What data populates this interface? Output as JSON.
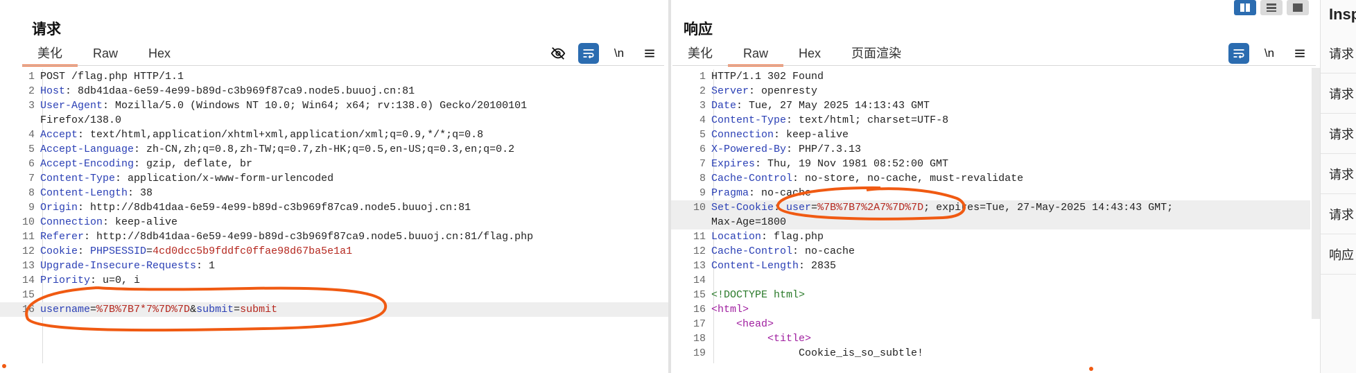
{
  "request": {
    "title": "请求",
    "tabs": [
      "美化",
      "Raw",
      "Hex"
    ],
    "active_tab": 0,
    "tool_newline": "\\n",
    "lines": [
      {
        "n": "1",
        "parts": [
          [
            "v",
            "POST /flag.php HTTP/1.1"
          ]
        ]
      },
      {
        "n": "2",
        "parts": [
          [
            "k",
            "Host"
          ],
          [
            "v",
            ": 8db41daa-6e59-4e99-b89d-c3b969f87ca9.node5.buuoj.cn:81"
          ]
        ]
      },
      {
        "n": "3",
        "parts": [
          [
            "k",
            "User-Agent"
          ],
          [
            "v",
            ": Mozilla/5.0 (Windows NT 10.0; Win64; x64; rv:138.0) Gecko/20100101"
          ]
        ]
      },
      {
        "n": "",
        "parts": [
          [
            "v",
            "Firefox/138.0"
          ]
        ]
      },
      {
        "n": "4",
        "parts": [
          [
            "k",
            "Accept"
          ],
          [
            "v",
            ": text/html,application/xhtml+xml,application/xml;q=0.9,*/*;q=0.8"
          ]
        ]
      },
      {
        "n": "5",
        "parts": [
          [
            "k",
            "Accept-Language"
          ],
          [
            "v",
            ": zh-CN,zh;q=0.8,zh-TW;q=0.7,zh-HK;q=0.5,en-US;q=0.3,en;q=0.2"
          ]
        ]
      },
      {
        "n": "6",
        "parts": [
          [
            "k",
            "Accept-Encoding"
          ],
          [
            "v",
            ": gzip, deflate, br"
          ]
        ]
      },
      {
        "n": "7",
        "parts": [
          [
            "k",
            "Content-Type"
          ],
          [
            "v",
            ": application/x-www-form-urlencoded"
          ]
        ]
      },
      {
        "n": "8",
        "parts": [
          [
            "k",
            "Content-Length"
          ],
          [
            "v",
            ": 38"
          ]
        ]
      },
      {
        "n": "9",
        "parts": [
          [
            "k",
            "Origin"
          ],
          [
            "v",
            ": http://8db41daa-6e59-4e99-b89d-c3b969f87ca9.node5.buuoj.cn:81"
          ]
        ]
      },
      {
        "n": "10",
        "parts": [
          [
            "k",
            "Connection"
          ],
          [
            "v",
            ": keep-alive"
          ]
        ]
      },
      {
        "n": "11",
        "parts": [
          [
            "k",
            "Referer"
          ],
          [
            "v",
            ": http://8db41daa-6e59-4e99-b89d-c3b969f87ca9.node5.buuoj.cn:81/flag.php"
          ]
        ]
      },
      {
        "n": "12",
        "parts": [
          [
            "k",
            "Cookie"
          ],
          [
            "v",
            ": "
          ],
          [
            "k",
            "PHPSESSID"
          ],
          [
            "v",
            "="
          ],
          [
            "r",
            "4cd0dcc5b9fddfc0ffae98d67ba5e1a1"
          ]
        ]
      },
      {
        "n": "13",
        "parts": [
          [
            "k",
            "Upgrade-Insecure-Requests"
          ],
          [
            "v",
            ": 1"
          ]
        ]
      },
      {
        "n": "14",
        "parts": [
          [
            "k",
            "Priority"
          ],
          [
            "v",
            ": u=0, i"
          ]
        ]
      },
      {
        "n": "15",
        "parts": []
      },
      {
        "n": "16",
        "hl": true,
        "parts": [
          [
            "k",
            "username"
          ],
          [
            "v",
            "="
          ],
          [
            "r",
            "%7B%7B7*7%7D%7D"
          ],
          [
            "v",
            "&"
          ],
          [
            "k",
            "submit"
          ],
          [
            "v",
            "="
          ],
          [
            "r",
            "submit"
          ]
        ]
      }
    ]
  },
  "response": {
    "title": "响应",
    "tabs": [
      "美化",
      "Raw",
      "Hex",
      "页面渲染"
    ],
    "active_tab": 1,
    "tool_newline": "\\n",
    "lines": [
      {
        "n": "1",
        "parts": [
          [
            "v",
            "HTTP/1.1 302 Found"
          ]
        ]
      },
      {
        "n": "2",
        "parts": [
          [
            "k",
            "Server"
          ],
          [
            "v",
            ": openresty"
          ]
        ]
      },
      {
        "n": "3",
        "parts": [
          [
            "k",
            "Date"
          ],
          [
            "v",
            ": Tue, 27 May 2025 14:13:43 GMT"
          ]
        ]
      },
      {
        "n": "4",
        "parts": [
          [
            "k",
            "Content-Type"
          ],
          [
            "v",
            ": text/html; charset=UTF-8"
          ]
        ]
      },
      {
        "n": "5",
        "parts": [
          [
            "k",
            "Connection"
          ],
          [
            "v",
            ": keep-alive"
          ]
        ]
      },
      {
        "n": "6",
        "parts": [
          [
            "k",
            "X-Powered-By"
          ],
          [
            "v",
            ": PHP/7.3.13"
          ]
        ]
      },
      {
        "n": "7",
        "parts": [
          [
            "k",
            "Expires"
          ],
          [
            "v",
            ": Thu, 19 Nov 1981 08:52:00 GMT"
          ]
        ]
      },
      {
        "n": "8",
        "parts": [
          [
            "k",
            "Cache-Control"
          ],
          [
            "v",
            ": no-store, no-cache, must-revalidate"
          ]
        ]
      },
      {
        "n": "9",
        "parts": [
          [
            "k",
            "Pragma"
          ],
          [
            "v",
            ": no-cache"
          ]
        ]
      },
      {
        "n": "10",
        "hl": true,
        "parts": [
          [
            "k",
            "Set-Cookie"
          ],
          [
            "v",
            ": "
          ],
          [
            "k",
            "user"
          ],
          [
            "v",
            "="
          ],
          [
            "r",
            "%7B%7B7%2A7%7D%7D"
          ],
          [
            "v",
            "; expires=Tue, 27-May-2025 14:43:43 GMT;"
          ]
        ]
      },
      {
        "n": "",
        "hl": true,
        "parts": [
          [
            "v",
            "Max-Age=1800"
          ]
        ]
      },
      {
        "n": "11",
        "parts": [
          [
            "k",
            "Location"
          ],
          [
            "v",
            ": flag.php"
          ]
        ]
      },
      {
        "n": "12",
        "parts": [
          [
            "k",
            "Cache-Control"
          ],
          [
            "v",
            ": no-cache"
          ]
        ]
      },
      {
        "n": "13",
        "parts": [
          [
            "k",
            "Content-Length"
          ],
          [
            "v",
            ": 2835"
          ]
        ]
      },
      {
        "n": "14",
        "parts": []
      },
      {
        "n": "15",
        "parts": [
          [
            "doc",
            "<!DOCTYPE html>"
          ]
        ]
      },
      {
        "n": "16",
        "parts": [
          [
            "tag",
            "<html>"
          ]
        ]
      },
      {
        "n": "17",
        "parts": [
          [
            "v",
            "    "
          ],
          [
            "tag",
            "<head>"
          ]
        ]
      },
      {
        "n": "18",
        "parts": [
          [
            "v",
            "         "
          ],
          [
            "tag",
            "<title>"
          ]
        ]
      },
      {
        "n": "19",
        "parts": [
          [
            "v",
            "              Cookie_is_so_subtle!"
          ]
        ]
      }
    ]
  },
  "inspector": {
    "title": "Insp",
    "items": [
      "请求",
      "请求",
      "请求",
      "请求",
      "请求",
      "响应"
    ]
  },
  "icons": {
    "hide": "eye-off-icon",
    "wrap": "wrap-icon",
    "newline": "newline-icon",
    "menu": "menu-icon"
  },
  "colors": {
    "accent": "#e8612c",
    "key": "#2a3fb5",
    "value_red": "#b5271e",
    "tool_active": "#2b6cb0",
    "annotation": "#f05a12"
  }
}
